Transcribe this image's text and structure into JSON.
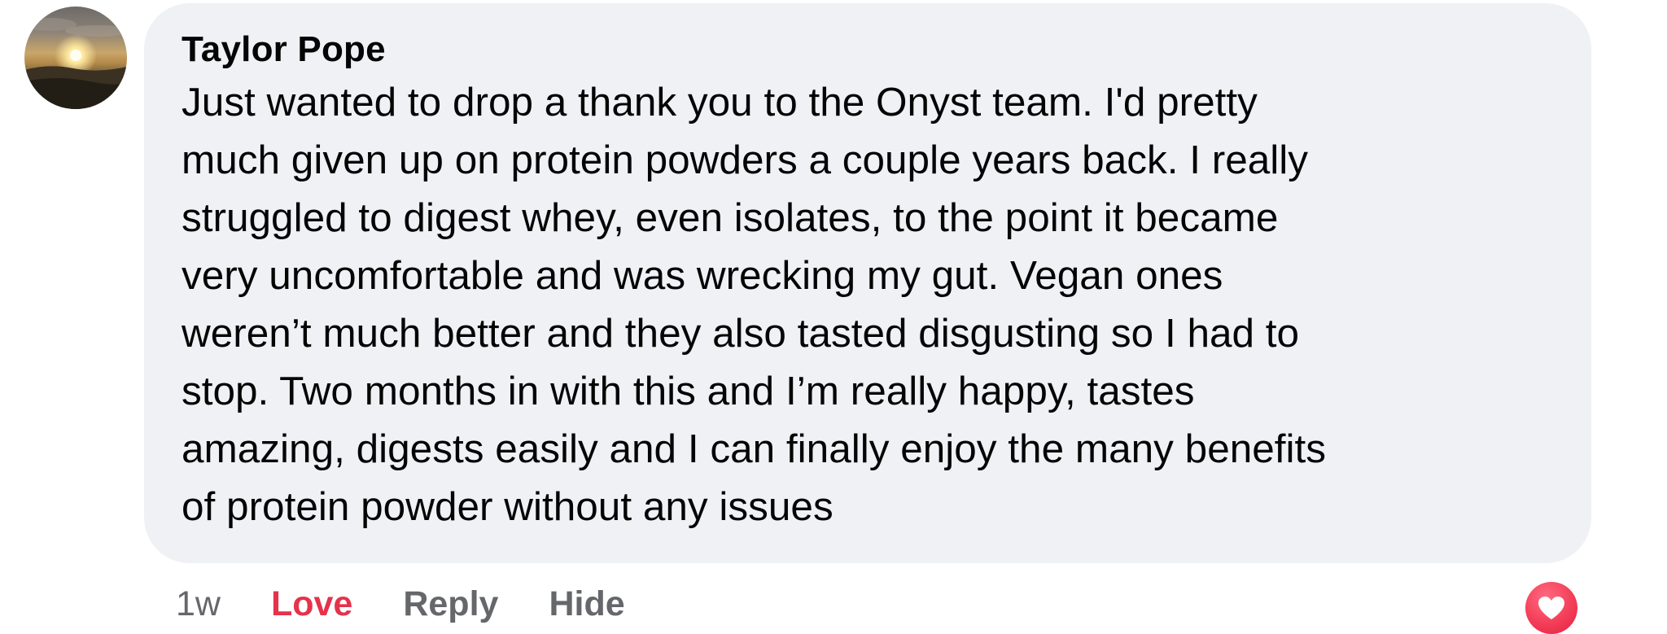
{
  "comment": {
    "author": "Taylor Pope",
    "text": "Just wanted to drop a thank you to the Onyst team. I'd pretty\nmuch given up on protein powders a couple years back. I really\nstruggled to digest whey, even isolates, to the point it became\nvery uncomfortable and was wrecking my gut. Vegan ones\nweren’t much better and they also tasted disgusting so I had to\nstop. Two months in with this and I’m really happy, tastes\namazing, digests easily and I can finally enjoy the many benefits\nof protein powder without any issues",
    "avatar_icon": "sunset-photo-avatar",
    "bubble_color": "#eff1f4"
  },
  "actions": {
    "timestamp": "1w",
    "love_label": "Love",
    "reply_label": "Reply",
    "hide_label": "Hide",
    "love_color": "#e4334a",
    "muted_color": "#65676b"
  },
  "reaction": {
    "icon": "love-heart-icon",
    "color": "#f33e58"
  }
}
